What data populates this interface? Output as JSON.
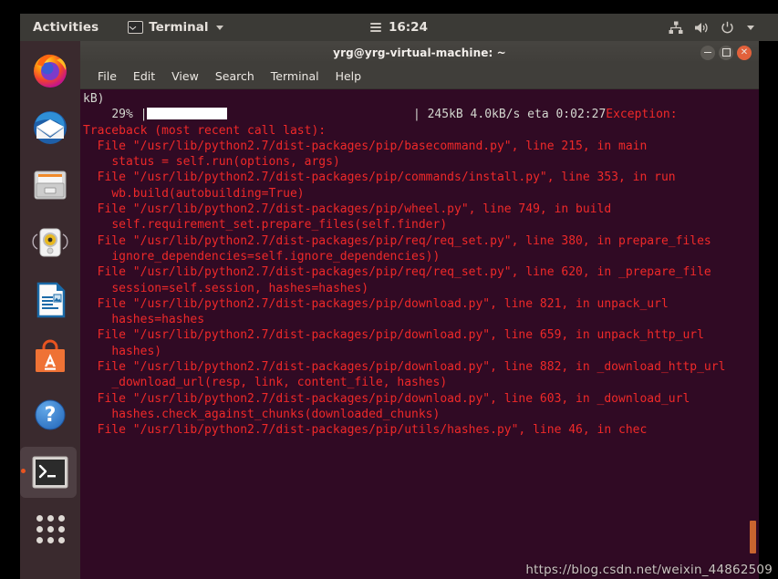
{
  "topbar": {
    "activities_label": "Activities",
    "app_menu_label": "Terminal",
    "app_menu_icon": "terminal-icon",
    "clock": "16:24",
    "calendar_icon": "hamburger-menu-icon",
    "status_icons": [
      "network-icon",
      "volume-icon",
      "power-icon",
      "chevron-down-icon"
    ]
  },
  "dock": {
    "items": [
      {
        "name": "firefox",
        "label": "Firefox Web Browser",
        "icon": "firefox-icon",
        "active": false
      },
      {
        "name": "thunderbird",
        "label": "Thunderbird Mail",
        "icon": "thunderbird-icon",
        "active": false
      },
      {
        "name": "files",
        "label": "Files",
        "icon": "files-cabinet-icon",
        "active": false
      },
      {
        "name": "rhythmbox",
        "label": "Rhythmbox",
        "icon": "rhythmbox-speaker-icon",
        "active": false
      },
      {
        "name": "libreoffice-writer",
        "label": "LibreOffice Writer",
        "icon": "document-writer-icon",
        "active": false
      },
      {
        "name": "ubuntu-software",
        "label": "Ubuntu Software",
        "icon": "software-bag-icon",
        "active": false
      },
      {
        "name": "help",
        "label": "Help",
        "icon": "question-mark-icon",
        "active": false
      },
      {
        "name": "terminal",
        "label": "Terminal",
        "icon": "terminal-icon",
        "active": true
      },
      {
        "name": "show-applications",
        "label": "Show Applications",
        "icon": "app-grid-icon",
        "active": false
      }
    ]
  },
  "window": {
    "title": "yrg@yrg-virtual-machine: ~",
    "controls": {
      "minimize": "minimize-button",
      "maximize": "maximize-button",
      "close": "close-button"
    },
    "menu": [
      "File",
      "Edit",
      "View",
      "Search",
      "Terminal",
      "Help"
    ]
  },
  "terminal": {
    "progress": {
      "percent": "29%",
      "bar_left": "|",
      "bar_right": "|",
      "downloaded": "245kB",
      "speed": "4.0kB/s",
      "eta": "eta 0:02:27",
      "trailing": "Exception:"
    },
    "line_head": "kB)",
    "progress_line_prefix": "    29% |",
    "progress_line_suffix": "                          | 245kB 4.0kB/s eta 0:02:27",
    "exception_label": "Exception:",
    "traceback": [
      "Traceback (most recent call last):",
      "  File \"/usr/lib/python2.7/dist-packages/pip/basecommand.py\", line 215, in main",
      "    status = self.run(options, args)",
      "  File \"/usr/lib/python2.7/dist-packages/pip/commands/install.py\", line 353, in run",
      "    wb.build(autobuilding=True)",
      "  File \"/usr/lib/python2.7/dist-packages/pip/wheel.py\", line 749, in build",
      "    self.requirement_set.prepare_files(self.finder)",
      "  File \"/usr/lib/python2.7/dist-packages/pip/req/req_set.py\", line 380, in prepare_files",
      "    ignore_dependencies=self.ignore_dependencies))",
      "  File \"/usr/lib/python2.7/dist-packages/pip/req/req_set.py\", line 620, in _prepare_file",
      "    session=self.session, hashes=hashes)",
      "  File \"/usr/lib/python2.7/dist-packages/pip/download.py\", line 821, in unpack_url",
      "    hashes=hashes",
      "  File \"/usr/lib/python2.7/dist-packages/pip/download.py\", line 659, in unpack_http_url",
      "    hashes)",
      "  File \"/usr/lib/python2.7/dist-packages/pip/download.py\", line 882, in _download_http_url",
      "    _download_url(resp, link, content_file, hashes)",
      "  File \"/usr/lib/python2.7/dist-packages/pip/download.py\", line 603, in _download_url",
      "    hashes.check_against_chunks(downloaded_chunks)",
      "  File \"/usr/lib/python2.7/dist-packages/pip/utils/hashes.py\", line 46, in chec"
    ]
  },
  "watermark": "https://blog.csdn.net/weixin_44862509",
  "colors": {
    "terminal_bg": "#300a24",
    "terminal_red": "#ef2929",
    "terminal_fg": "#d3d7cf",
    "accent_orange": "#e95420",
    "topbar_bg": "#3b3a36",
    "dock_bg": "#3c2b30",
    "titlebar_bg": "#44423e"
  }
}
